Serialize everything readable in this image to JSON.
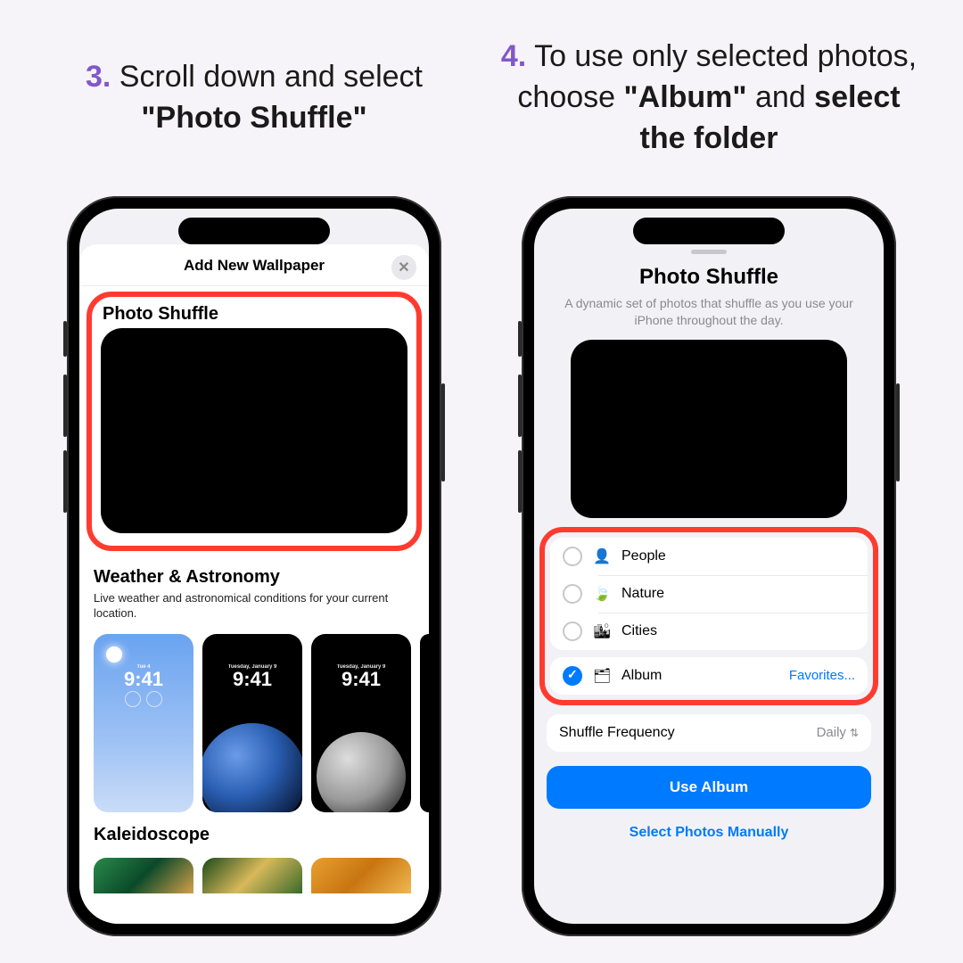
{
  "step3": {
    "number": "3.",
    "text_a": " Scroll down and select ",
    "bold": "\"Photo Shuffle\""
  },
  "step4": {
    "number": "4.",
    "text_a": " To use only selected photos, choose ",
    "bold_a": "\"Album\"",
    "text_b": " and ",
    "bold_b": "select the folder"
  },
  "phone1": {
    "modal_title": "Add New Wallpaper",
    "close": "✕",
    "photo_shuffle_title": "Photo Shuffle",
    "weather": {
      "title": "Weather & Astronomy",
      "subtitle": "Live weather and astronomical conditions for your current location."
    },
    "thumb_date_a": "Tue 4",
    "thumb_date_b": "Tuesday, January 9",
    "thumb_time": "9:41",
    "kaleidoscope_title": "Kaleidoscope"
  },
  "phone2": {
    "title": "Photo Shuffle",
    "subtitle": "A dynamic set of photos that shuffle as you use your iPhone throughout the day.",
    "options": {
      "people": "People",
      "nature": "Nature",
      "cities": "Cities",
      "album": "Album",
      "album_value": "Favorites..."
    },
    "freq_label": "Shuffle Frequency",
    "freq_value": "Daily",
    "use_album": "Use Album",
    "select_manual": "Select Photos Manually"
  }
}
